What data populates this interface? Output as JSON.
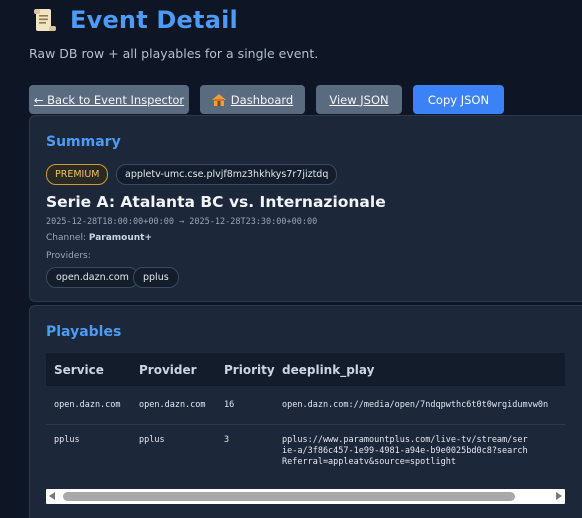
{
  "header": {
    "icon": "scroll-icon",
    "title": "Event Detail",
    "subtitle": "Raw DB row + all playables for a single event."
  },
  "toolbar": {
    "back_label": "← Back to Event Inspector",
    "dashboard_label": "Dashboard",
    "view_json_label": "View JSON",
    "copy_json_label": "Copy JSON"
  },
  "summary": {
    "title": "Summary",
    "tier_badge": "PREMIUM",
    "event_id": "appletv-umc.cse.plvjf8mz3hkhkys7r7jiztdq",
    "event_name": "Serie A: Atalanta BC vs. Internazionale",
    "time_range": "2025-12-28T18:00:00+00:00 → 2025-12-28T23:30:00+00:00",
    "channel_label": "Channel:",
    "channel_value": "Paramount+",
    "providers_label": "Providers:",
    "providers": [
      "open.dazn.com",
      "pplus"
    ]
  },
  "playables": {
    "title": "Playables",
    "columns": [
      "Service",
      "Provider",
      "Priority",
      "deeplink_play"
    ],
    "rows": [
      {
        "service": "open.dazn.com",
        "provider": "open.dazn.com",
        "priority": "16",
        "deeplink_play": "open.dazn.com://media/open/7ndqpwthc6t0t0wrgidumvw0n"
      },
      {
        "service": "pplus",
        "provider": "pplus",
        "priority": "3",
        "deeplink_play": "pplus://www.paramountplus.com/live-tv/stream/serie-a/3f86c457-1e99-4981-a94e-b9e0025bd0c8?searchReferral=appleatv&source=spotlight"
      }
    ]
  },
  "colors": {
    "accent": "#4d9bf5",
    "background": "#0e1626",
    "card": "#1c2739",
    "primary_button": "#3b82f6",
    "secondary_button": "#5a6a7f",
    "premium_badge": "#d19b2e"
  }
}
